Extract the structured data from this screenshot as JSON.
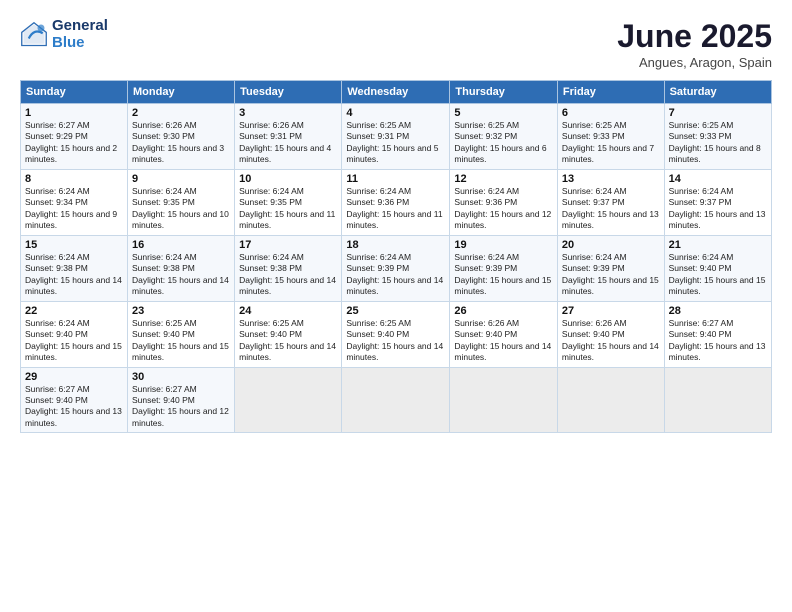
{
  "header": {
    "logo_line1": "General",
    "logo_line2": "Blue",
    "month": "June 2025",
    "location": "Angues, Aragon, Spain"
  },
  "weekdays": [
    "Sunday",
    "Monday",
    "Tuesday",
    "Wednesday",
    "Thursday",
    "Friday",
    "Saturday"
  ],
  "weeks": [
    [
      {
        "day": "1",
        "sunrise": "6:27 AM",
        "sunset": "9:29 PM",
        "daylight": "15 hours and 2 minutes."
      },
      {
        "day": "2",
        "sunrise": "6:26 AM",
        "sunset": "9:30 PM",
        "daylight": "15 hours and 3 minutes."
      },
      {
        "day": "3",
        "sunrise": "6:26 AM",
        "sunset": "9:31 PM",
        "daylight": "15 hours and 4 minutes."
      },
      {
        "day": "4",
        "sunrise": "6:25 AM",
        "sunset": "9:31 PM",
        "daylight": "15 hours and 5 minutes."
      },
      {
        "day": "5",
        "sunrise": "6:25 AM",
        "sunset": "9:32 PM",
        "daylight": "15 hours and 6 minutes."
      },
      {
        "day": "6",
        "sunrise": "6:25 AM",
        "sunset": "9:33 PM",
        "daylight": "15 hours and 7 minutes."
      },
      {
        "day": "7",
        "sunrise": "6:25 AM",
        "sunset": "9:33 PM",
        "daylight": "15 hours and 8 minutes."
      }
    ],
    [
      {
        "day": "8",
        "sunrise": "6:24 AM",
        "sunset": "9:34 PM",
        "daylight": "15 hours and 9 minutes."
      },
      {
        "day": "9",
        "sunrise": "6:24 AM",
        "sunset": "9:35 PM",
        "daylight": "15 hours and 10 minutes."
      },
      {
        "day": "10",
        "sunrise": "6:24 AM",
        "sunset": "9:35 PM",
        "daylight": "15 hours and 11 minutes."
      },
      {
        "day": "11",
        "sunrise": "6:24 AM",
        "sunset": "9:36 PM",
        "daylight": "15 hours and 11 minutes."
      },
      {
        "day": "12",
        "sunrise": "6:24 AM",
        "sunset": "9:36 PM",
        "daylight": "15 hours and 12 minutes."
      },
      {
        "day": "13",
        "sunrise": "6:24 AM",
        "sunset": "9:37 PM",
        "daylight": "15 hours and 13 minutes."
      },
      {
        "day": "14",
        "sunrise": "6:24 AM",
        "sunset": "9:37 PM",
        "daylight": "15 hours and 13 minutes."
      }
    ],
    [
      {
        "day": "15",
        "sunrise": "6:24 AM",
        "sunset": "9:38 PM",
        "daylight": "15 hours and 14 minutes."
      },
      {
        "day": "16",
        "sunrise": "6:24 AM",
        "sunset": "9:38 PM",
        "daylight": "15 hours and 14 minutes."
      },
      {
        "day": "17",
        "sunrise": "6:24 AM",
        "sunset": "9:38 PM",
        "daylight": "15 hours and 14 minutes."
      },
      {
        "day": "18",
        "sunrise": "6:24 AM",
        "sunset": "9:39 PM",
        "daylight": "15 hours and 14 minutes."
      },
      {
        "day": "19",
        "sunrise": "6:24 AM",
        "sunset": "9:39 PM",
        "daylight": "15 hours and 15 minutes."
      },
      {
        "day": "20",
        "sunrise": "6:24 AM",
        "sunset": "9:39 PM",
        "daylight": "15 hours and 15 minutes."
      },
      {
        "day": "21",
        "sunrise": "6:24 AM",
        "sunset": "9:40 PM",
        "daylight": "15 hours and 15 minutes."
      }
    ],
    [
      {
        "day": "22",
        "sunrise": "6:24 AM",
        "sunset": "9:40 PM",
        "daylight": "15 hours and 15 minutes."
      },
      {
        "day": "23",
        "sunrise": "6:25 AM",
        "sunset": "9:40 PM",
        "daylight": "15 hours and 15 minutes."
      },
      {
        "day": "24",
        "sunrise": "6:25 AM",
        "sunset": "9:40 PM",
        "daylight": "15 hours and 14 minutes."
      },
      {
        "day": "25",
        "sunrise": "6:25 AM",
        "sunset": "9:40 PM",
        "daylight": "15 hours and 14 minutes."
      },
      {
        "day": "26",
        "sunrise": "6:26 AM",
        "sunset": "9:40 PM",
        "daylight": "15 hours and 14 minutes."
      },
      {
        "day": "27",
        "sunrise": "6:26 AM",
        "sunset": "9:40 PM",
        "daylight": "15 hours and 14 minutes."
      },
      {
        "day": "28",
        "sunrise": "6:27 AM",
        "sunset": "9:40 PM",
        "daylight": "15 hours and 13 minutes."
      }
    ],
    [
      {
        "day": "29",
        "sunrise": "6:27 AM",
        "sunset": "9:40 PM",
        "daylight": "15 hours and 13 minutes."
      },
      {
        "day": "30",
        "sunrise": "6:27 AM",
        "sunset": "9:40 PM",
        "daylight": "15 hours and 12 minutes."
      },
      null,
      null,
      null,
      null,
      null
    ]
  ]
}
